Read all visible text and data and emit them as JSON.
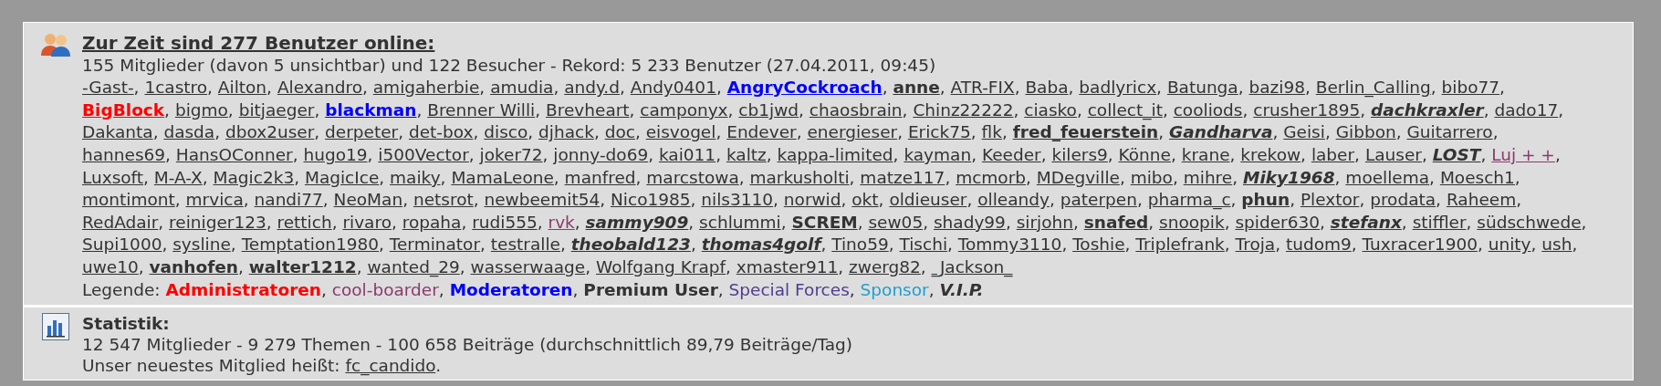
{
  "online": {
    "title": "Zur Zeit sind 277 Benutzer online:",
    "summary": "155 Mitglieder (davon 5 unsichtbar) und 122 Besucher - Rekord: 5 233 Benutzer (27.04.2011, 09:45)",
    "separator": ",",
    "user_lines": [
      [
        {
          "name": "-Gast-",
          "kind": "normal"
        },
        {
          "name": "1castro",
          "kind": "normal"
        },
        {
          "name": "Ailton",
          "kind": "normal"
        },
        {
          "name": "Alexandro",
          "kind": "normal"
        },
        {
          "name": "amigaherbie",
          "kind": "normal"
        },
        {
          "name": "amudia",
          "kind": "normal"
        },
        {
          "name": "andy.d",
          "kind": "normal"
        },
        {
          "name": "Andy0401",
          "kind": "normal"
        },
        {
          "name": "AngryCockroach",
          "kind": "moderator"
        },
        {
          "name": "anne",
          "kind": "premium"
        },
        {
          "name": "ATR-FIX",
          "kind": "normal"
        },
        {
          "name": "Baba",
          "kind": "normal"
        },
        {
          "name": "badlyricx",
          "kind": "normal"
        },
        {
          "name": "Batunga",
          "kind": "normal"
        },
        {
          "name": "bazi98",
          "kind": "normal"
        },
        {
          "name": "Berlin_Calling",
          "kind": "normal"
        },
        {
          "name": "bibo77",
          "kind": "normal"
        }
      ],
      [
        {
          "name": "BigBlock",
          "kind": "admin"
        },
        {
          "name": "bigmo",
          "kind": "normal"
        },
        {
          "name": "bitjaeger",
          "kind": "normal"
        },
        {
          "name": "blackman",
          "kind": "moderator"
        },
        {
          "name": "Brenner Willi",
          "kind": "normal"
        },
        {
          "name": "Brevheart",
          "kind": "normal"
        },
        {
          "name": "camponyx",
          "kind": "normal"
        },
        {
          "name": "cb1jwd",
          "kind": "normal"
        },
        {
          "name": "chaosbrain",
          "kind": "normal"
        },
        {
          "name": "Chinz22222",
          "kind": "normal"
        },
        {
          "name": "ciasko",
          "kind": "normal"
        },
        {
          "name": "collect_it",
          "kind": "normal"
        },
        {
          "name": "cooliods",
          "kind": "normal"
        },
        {
          "name": "crusher1895",
          "kind": "normal"
        },
        {
          "name": "dachkraxler",
          "kind": "vip"
        },
        {
          "name": "dado17",
          "kind": "normal"
        }
      ],
      [
        {
          "name": "Dakanta",
          "kind": "normal"
        },
        {
          "name": "dasda",
          "kind": "normal"
        },
        {
          "name": "dbox2user",
          "kind": "normal"
        },
        {
          "name": "derpeter",
          "kind": "normal"
        },
        {
          "name": "det-box",
          "kind": "normal"
        },
        {
          "name": "disco",
          "kind": "normal"
        },
        {
          "name": "djhack",
          "kind": "normal"
        },
        {
          "name": "doc",
          "kind": "normal"
        },
        {
          "name": "eisvogel",
          "kind": "normal"
        },
        {
          "name": "Endever",
          "kind": "normal"
        },
        {
          "name": "energieser",
          "kind": "normal"
        },
        {
          "name": "Erick75",
          "kind": "normal"
        },
        {
          "name": "flk",
          "kind": "normal"
        },
        {
          "name": "fred_feuerstein",
          "kind": "premium"
        },
        {
          "name": "Gandharva",
          "kind": "vip"
        },
        {
          "name": "Geisi",
          "kind": "normal"
        },
        {
          "name": "Gibbon",
          "kind": "normal"
        },
        {
          "name": "Guitarrero",
          "kind": "normal"
        }
      ],
      [
        {
          "name": "hannes69",
          "kind": "normal"
        },
        {
          "name": "HansOConner",
          "kind": "normal"
        },
        {
          "name": "hugo19",
          "kind": "normal"
        },
        {
          "name": "i500Vector",
          "kind": "normal"
        },
        {
          "name": "joker72",
          "kind": "normal"
        },
        {
          "name": "jonny-do69",
          "kind": "normal"
        },
        {
          "name": "kai011",
          "kind": "normal"
        },
        {
          "name": "kaltz",
          "kind": "normal"
        },
        {
          "name": "kappa-limited",
          "kind": "normal"
        },
        {
          "name": "kayman",
          "kind": "normal"
        },
        {
          "name": "Keeder",
          "kind": "normal"
        },
        {
          "name": "kilers9",
          "kind": "normal"
        },
        {
          "name": "Könne",
          "kind": "normal"
        },
        {
          "name": "krane",
          "kind": "normal"
        },
        {
          "name": "krekow",
          "kind": "normal"
        },
        {
          "name": "laber",
          "kind": "normal"
        },
        {
          "name": "Lauser",
          "kind": "normal"
        },
        {
          "name": "LOST",
          "kind": "vip"
        },
        {
          "name": "Luj + +",
          "kind": "cool"
        }
      ],
      [
        {
          "name": "Luxsoft",
          "kind": "normal"
        },
        {
          "name": "M-A-X",
          "kind": "normal"
        },
        {
          "name": "Magic2k3",
          "kind": "normal"
        },
        {
          "name": "MagicIce",
          "kind": "normal"
        },
        {
          "name": "maiky",
          "kind": "normal"
        },
        {
          "name": "MamaLeone",
          "kind": "normal"
        },
        {
          "name": "manfred",
          "kind": "normal"
        },
        {
          "name": "marcstowa",
          "kind": "normal"
        },
        {
          "name": "markusholti",
          "kind": "normal"
        },
        {
          "name": "matze117",
          "kind": "normal"
        },
        {
          "name": "mcmorb",
          "kind": "normal"
        },
        {
          "name": "MDegville",
          "kind": "normal"
        },
        {
          "name": "mibo",
          "kind": "normal"
        },
        {
          "name": "mihre",
          "kind": "normal"
        },
        {
          "name": "Miky1968",
          "kind": "vip"
        },
        {
          "name": "moellema",
          "kind": "normal"
        },
        {
          "name": "Moesch1",
          "kind": "normal"
        }
      ],
      [
        {
          "name": "montimont",
          "kind": "normal"
        },
        {
          "name": "mrvica",
          "kind": "normal"
        },
        {
          "name": "nandi77",
          "kind": "normal"
        },
        {
          "name": "NeoMan",
          "kind": "normal"
        },
        {
          "name": "netsrot",
          "kind": "normal"
        },
        {
          "name": "newbeemit54",
          "kind": "normal"
        },
        {
          "name": "Nico1985",
          "kind": "normal"
        },
        {
          "name": "nils3110",
          "kind": "normal"
        },
        {
          "name": "norwid",
          "kind": "normal"
        },
        {
          "name": "okt",
          "kind": "normal"
        },
        {
          "name": "oldieuser",
          "kind": "normal"
        },
        {
          "name": "olleandy",
          "kind": "normal"
        },
        {
          "name": "paterpen",
          "kind": "normal"
        },
        {
          "name": "pharma_c",
          "kind": "normal"
        },
        {
          "name": "phun",
          "kind": "premium"
        },
        {
          "name": "Plextor",
          "kind": "normal"
        },
        {
          "name": "prodata",
          "kind": "normal"
        },
        {
          "name": "Raheem",
          "kind": "normal"
        }
      ],
      [
        {
          "name": "RedAdair",
          "kind": "normal"
        },
        {
          "name": "reiniger123",
          "kind": "normal"
        },
        {
          "name": "rettich",
          "kind": "normal"
        },
        {
          "name": "rivaro",
          "kind": "normal"
        },
        {
          "name": "ropaha",
          "kind": "normal"
        },
        {
          "name": "rudi555",
          "kind": "normal"
        },
        {
          "name": "rvk",
          "kind": "cool"
        },
        {
          "name": "sammy909",
          "kind": "vip"
        },
        {
          "name": "schlummi",
          "kind": "normal"
        },
        {
          "name": "SCREM",
          "kind": "premium"
        },
        {
          "name": "sew05",
          "kind": "normal"
        },
        {
          "name": "shady99",
          "kind": "normal"
        },
        {
          "name": "sirjohn",
          "kind": "normal"
        },
        {
          "name": "snafed",
          "kind": "premium"
        },
        {
          "name": "snoopik",
          "kind": "normal"
        },
        {
          "name": "spider630",
          "kind": "normal"
        },
        {
          "name": "stefanx",
          "kind": "vip"
        },
        {
          "name": "stiffler",
          "kind": "normal"
        },
        {
          "name": "südschwede",
          "kind": "normal"
        }
      ],
      [
        {
          "name": "Supi1000",
          "kind": "normal"
        },
        {
          "name": "sysline",
          "kind": "normal"
        },
        {
          "name": "Temptation1980",
          "kind": "normal"
        },
        {
          "name": "Terminator",
          "kind": "normal"
        },
        {
          "name": "testralle",
          "kind": "normal"
        },
        {
          "name": "theobald123",
          "kind": "vip"
        },
        {
          "name": "thomas4golf",
          "kind": "vip"
        },
        {
          "name": "Tino59",
          "kind": "normal"
        },
        {
          "name": "Tischi",
          "kind": "normal"
        },
        {
          "name": "Tommy3110",
          "kind": "normal"
        },
        {
          "name": "Toshie",
          "kind": "normal"
        },
        {
          "name": "Triplefrank",
          "kind": "normal"
        },
        {
          "name": "Troja",
          "kind": "normal"
        },
        {
          "name": "tudom9",
          "kind": "normal"
        },
        {
          "name": "Tuxracer1900",
          "kind": "normal"
        },
        {
          "name": "unity",
          "kind": "normal"
        },
        {
          "name": "ush",
          "kind": "normal"
        }
      ],
      [
        {
          "name": "uwe10",
          "kind": "normal"
        },
        {
          "name": "vanhofen",
          "kind": "premium"
        },
        {
          "name": "walter1212",
          "kind": "premium"
        },
        {
          "name": "wanted_29",
          "kind": "normal"
        },
        {
          "name": "wasserwaage",
          "kind": "normal"
        },
        {
          "name": "Wolfgang Krapf",
          "kind": "normal"
        },
        {
          "name": "xmaster911",
          "kind": "normal"
        },
        {
          "name": "zwerg82",
          "kind": "normal"
        },
        {
          "name": "_Jackson_",
          "kind": "normal"
        }
      ]
    ],
    "legend": {
      "label": "Legende:",
      "groups": [
        {
          "name": "Administratoren",
          "kind": "admin"
        },
        {
          "name": "cool-boarder",
          "kind": "cool"
        },
        {
          "name": "Moderatoren",
          "kind": "moderator"
        },
        {
          "name": "Premium User",
          "kind": "premium"
        },
        {
          "name": "Special Forces",
          "kind": "special"
        },
        {
          "name": "Sponsor",
          "kind": "sponsor"
        },
        {
          "name": "V.I.P.",
          "kind": "vip"
        }
      ]
    }
  },
  "statistics": {
    "title": "Statistik:",
    "totals": "12 547 Mitglieder - 9 279 Themen - 100 658 Beiträge (durchschnittlich 89,79 Beiträge/Tag)",
    "newest_prefix": "Unser neuestes Mitglied heißt:",
    "newest_member": "fc_candido",
    "newest_suffix": "."
  }
}
